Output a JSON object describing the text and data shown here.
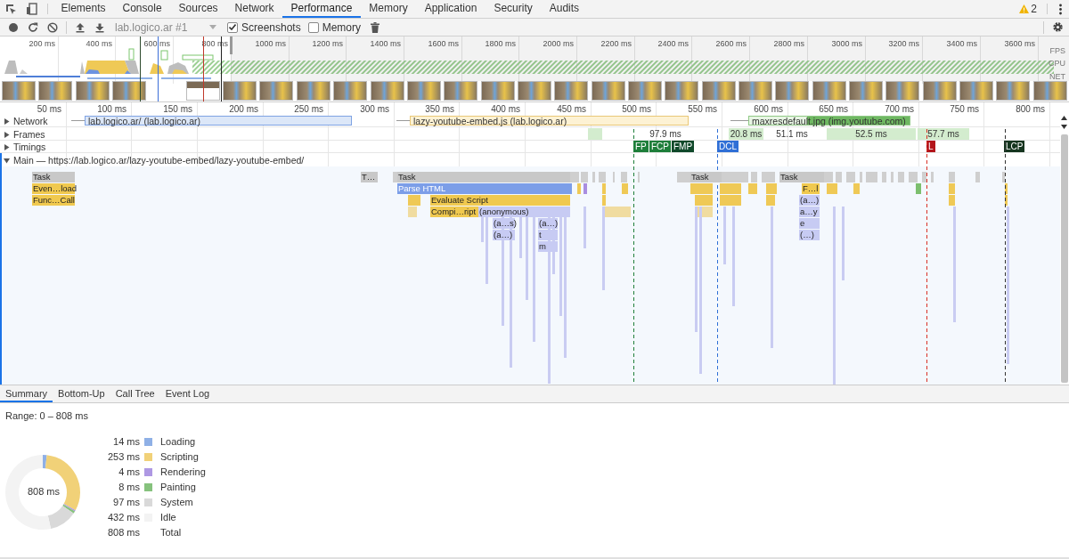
{
  "devtools_tabs": [
    {
      "label": "Elements",
      "selected": false
    },
    {
      "label": "Console",
      "selected": false
    },
    {
      "label": "Sources",
      "selected": false
    },
    {
      "label": "Network",
      "selected": false
    },
    {
      "label": "Performance",
      "selected": true
    },
    {
      "label": "Memory",
      "selected": false
    },
    {
      "label": "Application",
      "selected": false
    },
    {
      "label": "Security",
      "selected": false
    },
    {
      "label": "Audits",
      "selected": false
    }
  ],
  "warnings": {
    "count": "2"
  },
  "toolbar": {
    "recording_select": "lab.logico.ar #1",
    "checkboxes": [
      {
        "label": "Screenshots",
        "checked": true
      },
      {
        "label": "Memory",
        "checked": false
      }
    ]
  },
  "overview": {
    "ticks": [
      "200 ms",
      "400 ms",
      "600 ms",
      "800 ms",
      "1000 ms",
      "1200 ms",
      "1400 ms",
      "1600 ms",
      "1800 ms",
      "2000 ms",
      "2200 ms",
      "2400 ms",
      "2600 ms",
      "2800 ms",
      "3000 ms",
      "3200 ms",
      "3400 ms",
      "3600 ms"
    ],
    "track_labels": [
      "FPS",
      "CPU",
      "NET"
    ]
  },
  "timeline": {
    "ticks": [
      "50 ms",
      "100 ms",
      "150 ms",
      "200 ms",
      "250 ms",
      "300 ms",
      "350 ms",
      "400 ms",
      "450 ms",
      "500 ms",
      "550 ms",
      "600 ms",
      "650 ms",
      "700 ms",
      "750 ms",
      "800 ms"
    ],
    "network": {
      "label": "Network",
      "expanded": false,
      "requests": [
        {
          "label": "lab.logico.ar/ (lab.logico.ar)",
          "kind": "document"
        },
        {
          "label": "lazy-youtube-embed.js (lab.logico.ar)",
          "kind": "script"
        },
        {
          "label": "maxresdefault.jpg (img.youtube.com)",
          "kind": "image"
        }
      ]
    },
    "frames": {
      "label": "Frames",
      "expanded": false,
      "items": [
        {
          "label": "97.9 ms",
          "kind": "idle"
        },
        {
          "label": "20.8 ms",
          "kind": "rendered"
        },
        {
          "label": "51.1 ms",
          "kind": "idle"
        },
        {
          "label": "52.5 ms",
          "kind": "rendered"
        },
        {
          "label": "57.7 ms",
          "kind": "rendered"
        }
      ]
    },
    "timings": {
      "label": "Timings",
      "expanded": false,
      "markers": [
        {
          "label": "FP",
          "color": "#1e7e3a"
        },
        {
          "label": "FCP",
          "color": "#1e7e3a"
        },
        {
          "label": "FMP",
          "color": "#10492a"
        },
        {
          "label": "DCL",
          "color": "#2f6fd6"
        },
        {
          "label": "L",
          "color": "#b3141b"
        },
        {
          "label": "LCP",
          "color": "#15351f"
        }
      ]
    },
    "main": {
      "label": "Main — https://lab.logico.ar/lazy-youtube-embed/lazy-youtube-embed/",
      "expanded": true,
      "events": [
        {
          "label": "Task",
          "kind": "task"
        },
        {
          "label": "T…",
          "kind": "task"
        },
        {
          "label": "Task",
          "kind": "task"
        },
        {
          "label": "Task",
          "kind": "task"
        },
        {
          "label": "Task",
          "kind": "task"
        },
        {
          "label": "Even…load",
          "kind": "scripting"
        },
        {
          "label": "Parse HTML",
          "kind": "loading"
        },
        {
          "label": "F…l",
          "kind": "scripting"
        },
        {
          "label": "Func…Call",
          "kind": "scripting"
        },
        {
          "label": "Evaluate Script",
          "kind": "scripting"
        },
        {
          "label": "(a…)",
          "kind": "function"
        },
        {
          "label": "Compi…ript",
          "kind": "scripting"
        },
        {
          "label": "(anonymous)",
          "kind": "function"
        },
        {
          "label": "a…y",
          "kind": "function"
        },
        {
          "label": "(a…s)",
          "kind": "function"
        },
        {
          "label": "(a…)",
          "kind": "function"
        },
        {
          "label": "e",
          "kind": "function"
        },
        {
          "label": "(a…)",
          "kind": "function"
        },
        {
          "label": "t",
          "kind": "function"
        },
        {
          "label": "(…)",
          "kind": "function"
        },
        {
          "label": "m",
          "kind": "function"
        }
      ]
    }
  },
  "bottom_tabs": [
    {
      "label": "Summary",
      "selected": true
    },
    {
      "label": "Bottom-Up",
      "selected": false
    },
    {
      "label": "Call Tree",
      "selected": false
    },
    {
      "label": "Event Log",
      "selected": false
    }
  ],
  "summary": {
    "range": "Range: 0 – 808 ms",
    "center_label": "808 ms",
    "legend": [
      {
        "value": "14 ms",
        "color": "#8fb0e6"
      },
      {
        "value": "253 ms",
        "color": "#f1d178"
      },
      {
        "value": "4 ms",
        "color": "#ae98e3"
      },
      {
        "value": "8 ms",
        "color": "#86c27d"
      },
      {
        "value": "97 ms",
        "color": "#d9d9d9"
      },
      {
        "value": "432 ms",
        "color": "#f3f3f3"
      }
    ],
    "total": {
      "value": "808 ms",
      "label": "Total"
    },
    "chart_data": {
      "type": "donut",
      "categories": [
        "Loading",
        "Scripting",
        "Rendering",
        "Painting",
        "System",
        "Idle"
      ],
      "values": [
        1.733,
        31.312,
        0.495,
        0.99,
        12.005,
        53.465
      ]
    }
  }
}
